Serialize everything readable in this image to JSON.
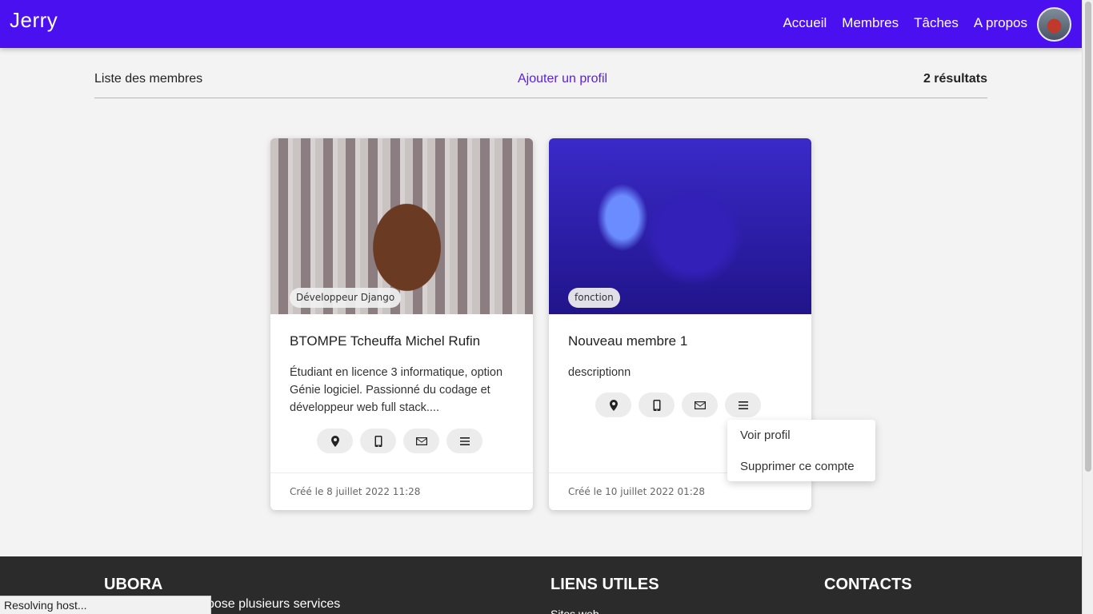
{
  "navbar": {
    "brand": "Jerry",
    "links": [
      "Accueil",
      "Membres",
      "Tâches",
      "A propos"
    ]
  },
  "toolbar": {
    "title": "Liste des membres",
    "add_label": "Ajouter un profil",
    "result_count": "2 résultats"
  },
  "members": [
    {
      "role": "Développeur Django",
      "name": "BTOMPE Tcheuffa Michel Rufin",
      "description": "Étudiant en licence 3 informatique, option Génie logiciel. Passionné du codage et développeur web full stack....",
      "created": "Créé le 8 juillet 2022 11:28"
    },
    {
      "role": "fonction",
      "name": "Nouveau membre 1",
      "description": "descriptionn",
      "created": "Créé le 10 juillet 2022 01:28"
    }
  ],
  "actions": {
    "icons": [
      "location-pin-icon",
      "mobile-phone-icon",
      "envelope-icon",
      "menu-icon"
    ]
  },
  "dropdown": {
    "items": [
      "Voir profil",
      "Supprimer ce compte"
    ]
  },
  "footer": {
    "col1_title": "UBORA",
    "col1_desc": "...ntreprise qui propose plusieurs services",
    "col2_title": "LIENS UTILES",
    "col2_link": "Sites web",
    "col3_title": "CONTACTS"
  },
  "status_bar": "Resolving host..."
}
